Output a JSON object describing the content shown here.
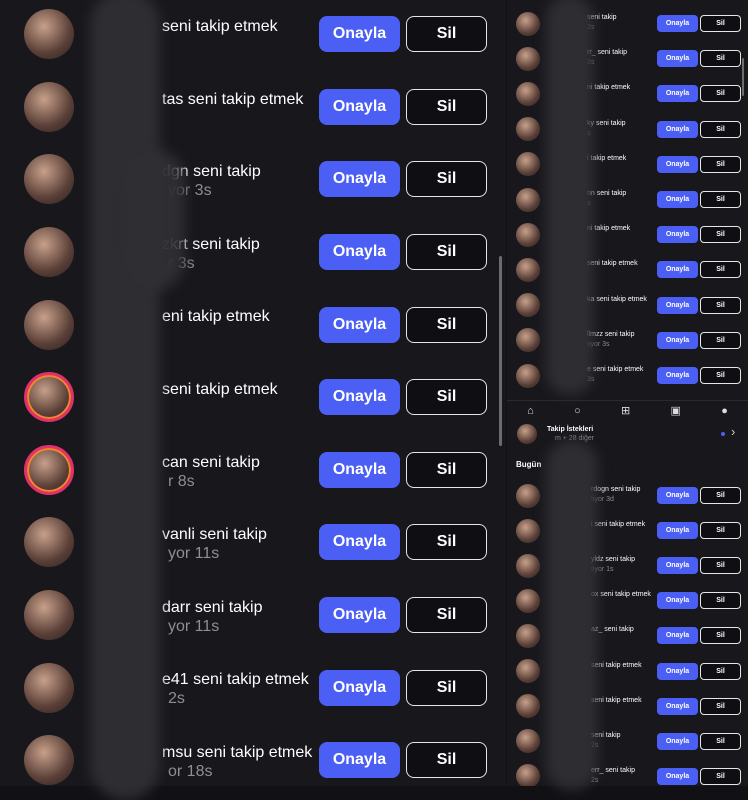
{
  "left": {
    "rows": [
      {
        "text": "seni takip etmek",
        "time": "",
        "ring": false
      },
      {
        "text": "tas seni takip etmek",
        "time": "",
        "ring": false
      },
      {
        "text": "dgn seni takip",
        "time": "yor 3s",
        "ring": false
      },
      {
        "text": "zkrt seni takip",
        "time": "r 3s",
        "ring": false
      },
      {
        "text": "eni takip etmek",
        "time": "",
        "ring": false
      },
      {
        "text": "seni takip etmek",
        "time": "",
        "ring": true
      },
      {
        "text": "can seni takip",
        "time": "r 8s",
        "ring": true
      },
      {
        "text": "vanli seni takip",
        "time": "yor 11s",
        "ring": false
      },
      {
        "text": "darr seni takip",
        "time": "yor 11s",
        "ring": false
      },
      {
        "text": "e41 seni takip etmek",
        "time": "2s",
        "ring": false
      },
      {
        "text": "msu seni takip etmek",
        "time": "or 18s",
        "ring": false
      }
    ],
    "onayla_label": "Onayla",
    "sil_label": "Sil"
  },
  "right_top": {
    "rows": [
      {
        "text": "seni takip",
        "time": "2s"
      },
      {
        "text": "rr_ seni takip",
        "time": "2s"
      },
      {
        "text": "ni takip etmek",
        "time": ""
      },
      {
        "text": "ky seni takip",
        "time": "s"
      },
      {
        "text": "i takip etmek",
        "time": ""
      },
      {
        "text": "nn seni takip",
        "time": "s"
      },
      {
        "text": "ni takip etmek",
        "time": ""
      },
      {
        "text": "seni takip etmek",
        "time": ""
      },
      {
        "text": "ka seni takip etmek",
        "time": ""
      },
      {
        "text": "llmzz seni takip",
        "time": "tiyor 3s"
      },
      {
        "text": "e seni takip etmek",
        "time": "3s"
      }
    ],
    "onayla_label": "Onayla",
    "sil_label": "Sil"
  },
  "nav": {
    "home": "⌂",
    "search": "○",
    "add": "⊞",
    "reels": "▣",
    "profile": "●"
  },
  "right_bottom": {
    "header_title": "Takip İstekleri",
    "header_sub": "m + 28 diğer",
    "chevron": "›",
    "section_label": "Bugün",
    "rows": [
      {
        "text": "rdogn seni takip",
        "time": "tiyor 3d"
      },
      {
        "text": "i seni takip etmek",
        "time": ""
      },
      {
        "text": "yldz seni takip",
        "time": "tiyor 1s"
      },
      {
        "text": "ox seni takip etmek",
        "time": ""
      },
      {
        "text": "az_ seni takip",
        "time": ""
      },
      {
        "text": "seni takip etmek",
        "time": ""
      },
      {
        "text": "seni takip etmek",
        "time": ""
      },
      {
        "text": "seni takip",
        "time": "2s"
      },
      {
        "text": "err_ seni takip",
        "time": "2s"
      }
    ],
    "onayla_label": "Onayla",
    "sil_label": "Sil"
  }
}
